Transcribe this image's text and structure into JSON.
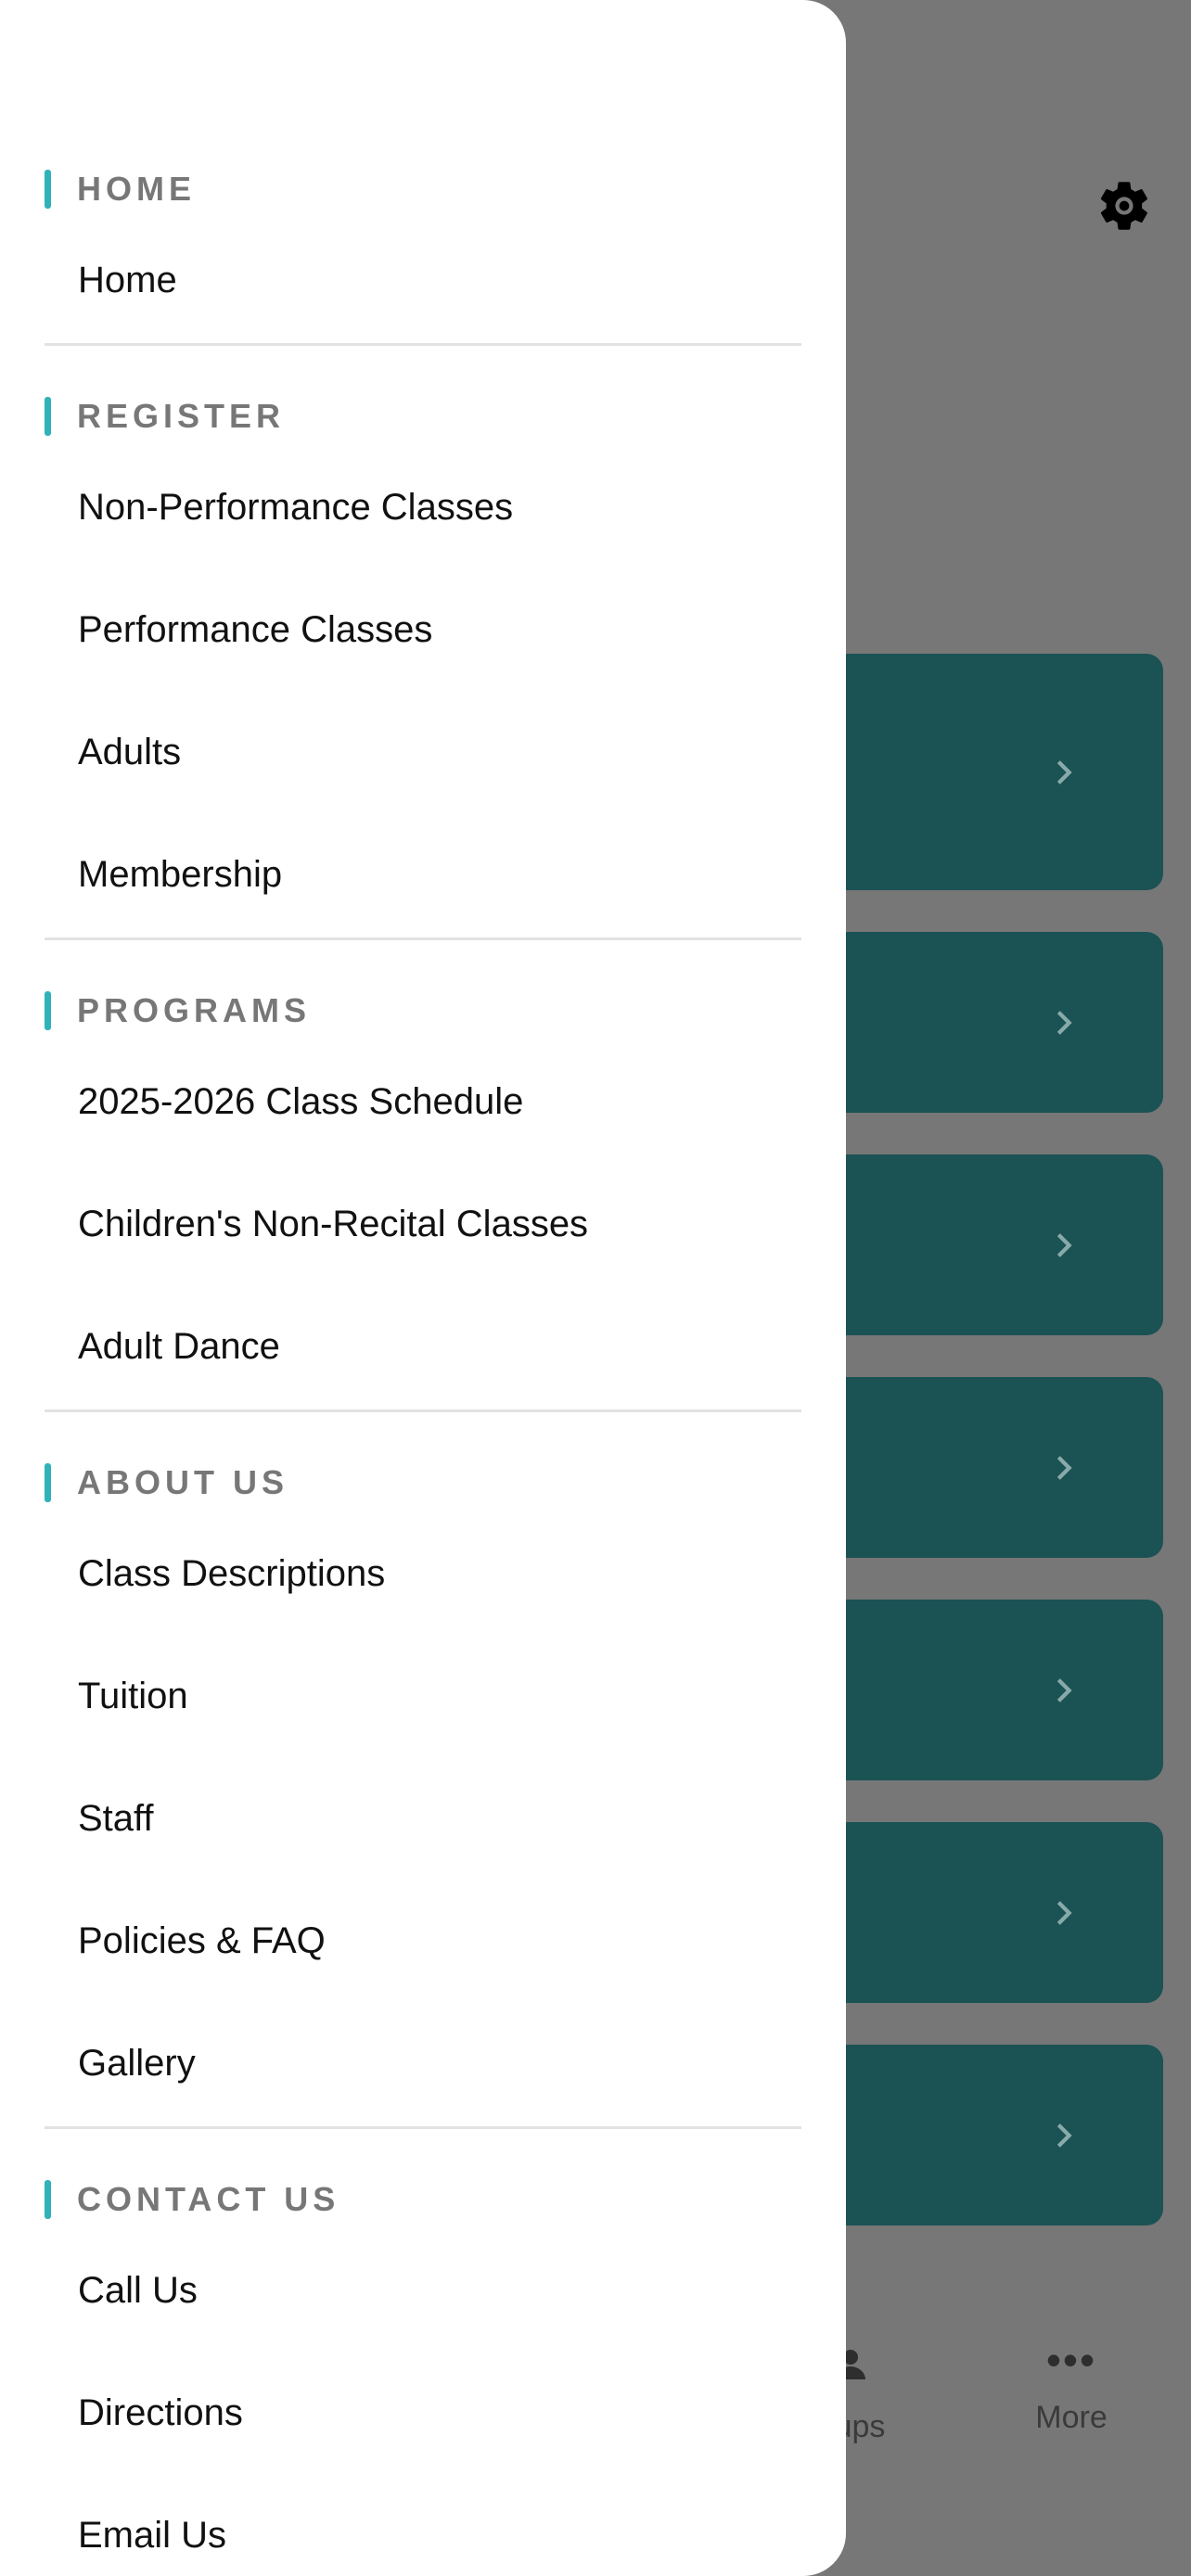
{
  "drawer": {
    "sections": [
      {
        "title": "HOME",
        "items": [
          "Home"
        ]
      },
      {
        "title": "REGISTER",
        "items": [
          "Non-Performance Classes",
          "Performance Classes",
          "Adults",
          "Membership"
        ]
      },
      {
        "title": "PROGRAMS",
        "items": [
          "2025-2026 Class Schedule",
          "Children's Non-Recital Classes",
          "Adult Dance"
        ]
      },
      {
        "title": "ABOUT US",
        "items": [
          "Class Descriptions",
          "Tuition",
          "Staff",
          "Policies & FAQ",
          "Gallery"
        ]
      },
      {
        "title": "CONTACT US",
        "items": [
          "Call Us",
          "Directions",
          "Email Us"
        ]
      }
    ]
  },
  "background": {
    "icons": [
      "gear-icon",
      "chevron-right-icon",
      "people-icon",
      "more-icon"
    ],
    "tabbar": {
      "partial_label": "ups",
      "more_label": "More"
    },
    "colors": {
      "card": "#1b5254",
      "accent": "#2fb2ba",
      "overlay": "#777777"
    }
  }
}
